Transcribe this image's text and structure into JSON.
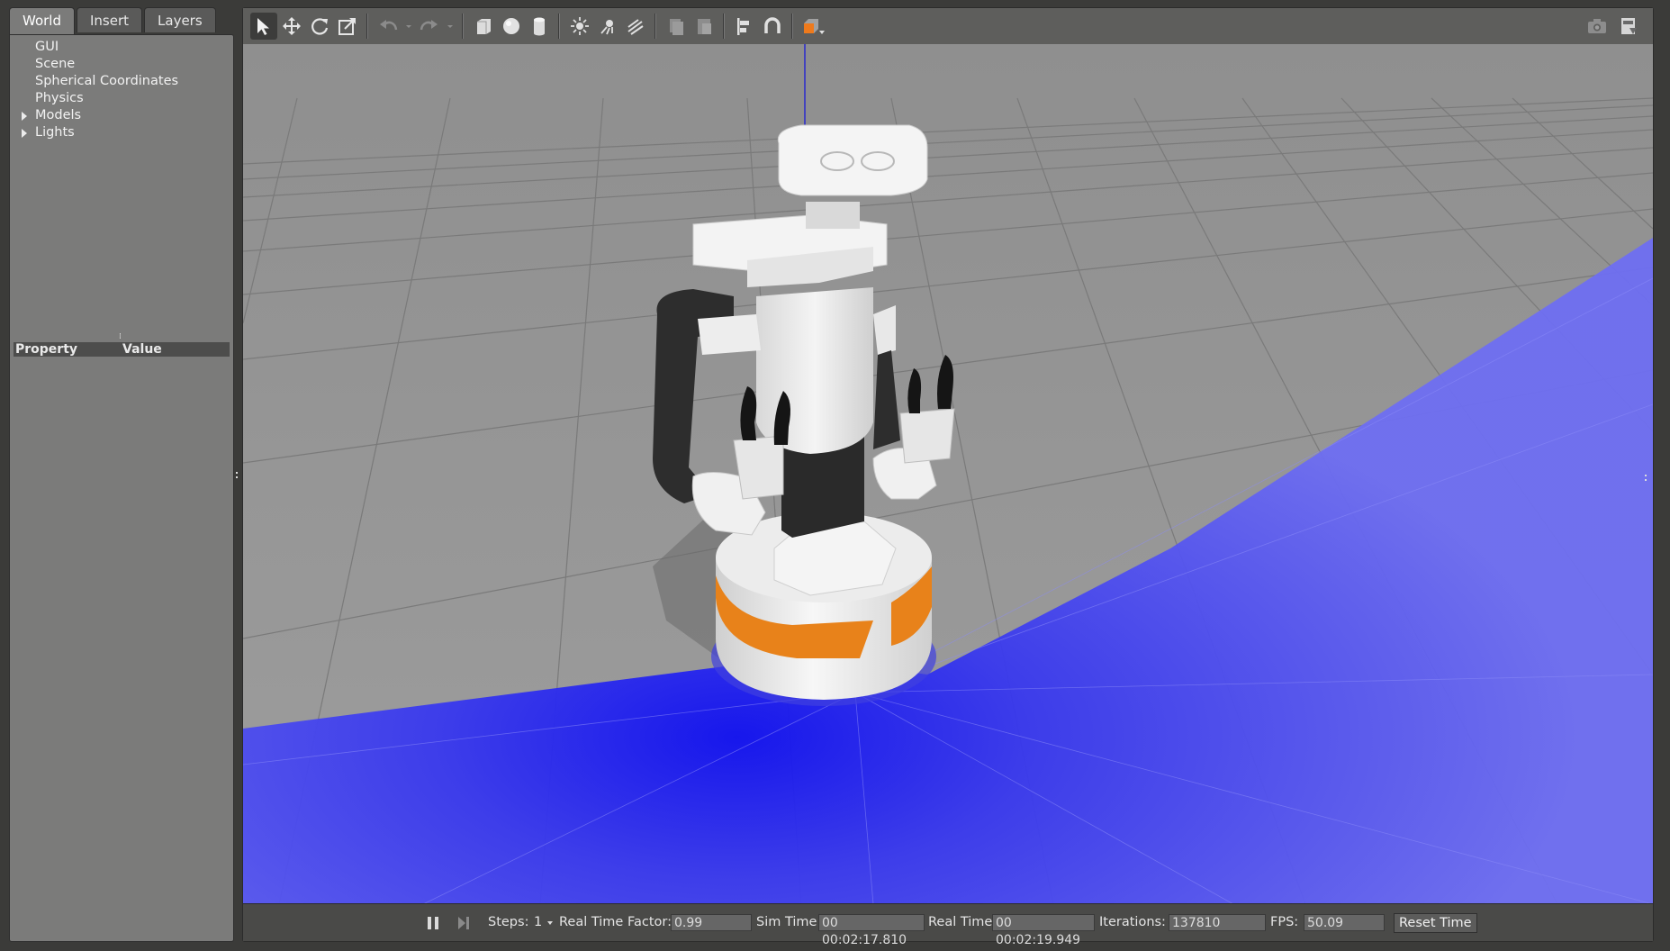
{
  "tabs": [
    {
      "label": "World"
    },
    {
      "label": "Insert"
    },
    {
      "label": "Layers"
    }
  ],
  "world_tree": {
    "items": [
      {
        "label": "GUI",
        "expandable": false
      },
      {
        "label": "Scene",
        "expandable": false
      },
      {
        "label": "Spherical Coordinates",
        "expandable": false
      },
      {
        "label": "Physics",
        "expandable": false
      },
      {
        "label": "Models",
        "expandable": true
      },
      {
        "label": "Lights",
        "expandable": true
      }
    ]
  },
  "properties": {
    "col_property": "Property",
    "col_value": "Value"
  },
  "toolbar": {
    "tools": [
      "select-arrow-icon",
      "translate-icon",
      "rotate-icon",
      "scale-icon",
      "undo-icon",
      "redo-icon",
      "box-icon",
      "sphere-icon",
      "cylinder-icon",
      "point-light-icon",
      "spot-light-icon",
      "directional-light-icon",
      "copy-icon",
      "paste-icon",
      "align-icon",
      "snap-icon",
      "view-angle-icon"
    ],
    "right_tools": [
      "screenshot-icon",
      "log-icon"
    ]
  },
  "status": {
    "steps_label": "Steps:",
    "steps_value": "1",
    "rtf_label": "Real Time Factor:",
    "rtf_value": "0.99",
    "sim_time_label": "Sim Time:",
    "sim_time_value": "00 00:02:17.810",
    "real_time_label": "Real Time:",
    "real_time_value": "00 00:02:19.949",
    "iterations_label": "Iterations:",
    "iterations_value": "137810",
    "fps_label": "FPS:",
    "fps_value": "50.09",
    "reset_label": "Reset Time"
  },
  "colors": {
    "ground": "#9a9a9a",
    "laser": "#4b4bff",
    "robot_accent": "#e8821a",
    "panel": "#7b7b7a"
  }
}
